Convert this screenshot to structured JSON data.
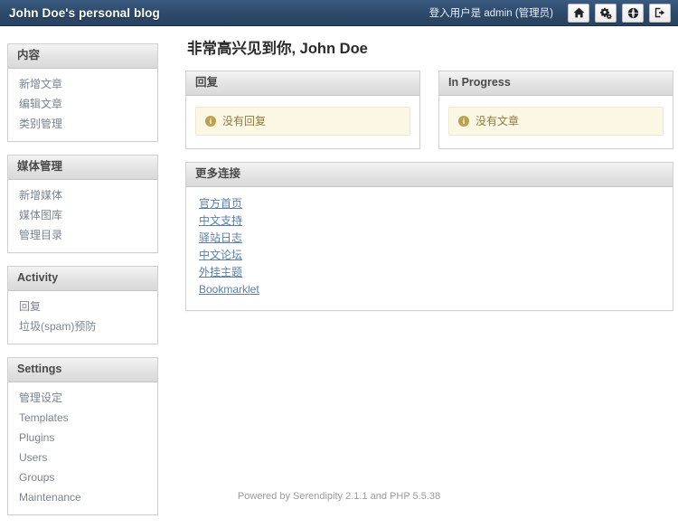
{
  "header": {
    "brand": "John Doe's personal blog",
    "login_info": "登入用户是 admin (管理员)",
    "buttons": [
      {
        "name": "home-icon",
        "label": "Frontend"
      },
      {
        "name": "gears-icon",
        "label": "Configuration"
      },
      {
        "name": "globe-icon",
        "label": "Language"
      },
      {
        "name": "logout-icon",
        "label": "Logout"
      }
    ]
  },
  "sidebar": {
    "panels": [
      {
        "title": "内容",
        "items": [
          {
            "label": "新增文章"
          },
          {
            "label": "编辑文章"
          },
          {
            "label": "类别管理"
          }
        ]
      },
      {
        "title": "媒体管理",
        "items": [
          {
            "label": "新增媒体"
          },
          {
            "label": "媒体图库"
          },
          {
            "label": "管理目录"
          }
        ]
      },
      {
        "title": "Activity",
        "items": [
          {
            "label": "回复"
          },
          {
            "label": "垃圾(spam)预防"
          }
        ]
      },
      {
        "title": "Settings",
        "items": [
          {
            "label": "管理设定"
          },
          {
            "label": "Templates"
          },
          {
            "label": "Plugins"
          },
          {
            "label": "Users"
          },
          {
            "label": "Groups"
          },
          {
            "label": "Maintenance"
          }
        ]
      }
    ]
  },
  "main": {
    "page_title": "非常高兴见到你, John Doe",
    "cards": [
      {
        "title": "回复",
        "notice": "没有回复"
      },
      {
        "title": "In Progress",
        "notice": "没有文章"
      }
    ],
    "links_panel": {
      "title": "更多连接",
      "links": [
        {
          "label": "官方首页"
        },
        {
          "label": "中文支持"
        },
        {
          "label": "驿站日志"
        },
        {
          "label": "中文论坛"
        },
        {
          "label": "外挂主题"
        },
        {
          "label": "Bookmarklet"
        }
      ]
    }
  },
  "footer": {
    "text": "Powered by Serendipity 2.1.1 and PHP 5.5.38"
  },
  "colors": {
    "header_bg": "#2d4968",
    "notice_bg": "#fbf7e4",
    "notice_text": "#8d7a3f",
    "link": "#5a7fa8"
  }
}
